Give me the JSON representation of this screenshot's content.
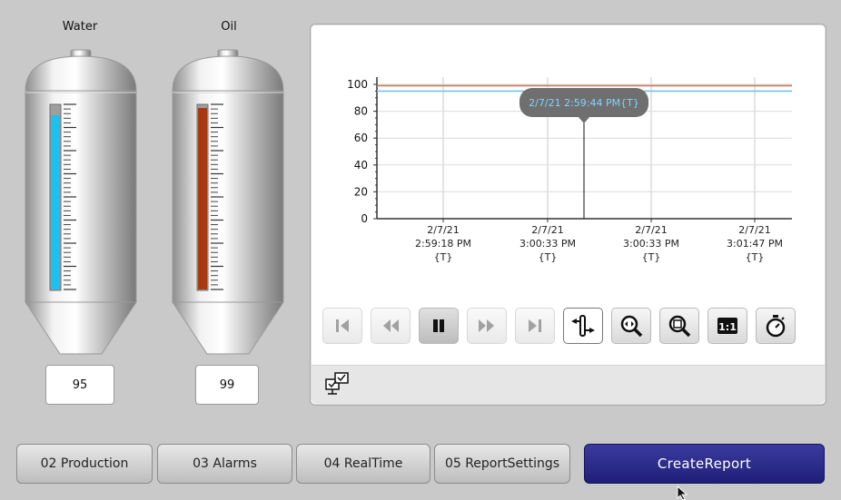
{
  "tanks": [
    {
      "label": "Water",
      "value": "95",
      "level": 0.95,
      "color": "#1ec0f2"
    },
    {
      "label": "Oil",
      "value": "99",
      "level": 0.99,
      "color": "#a83a12"
    }
  ],
  "chart_data": {
    "type": "line",
    "y_ticks": [
      "100",
      "80",
      "60",
      "40",
      "20",
      "0"
    ],
    "ylim": [
      0,
      100
    ],
    "x_ticks": [
      {
        "date": "2/7/21",
        "time": "2:59:18 PM",
        "zone": "{T}"
      },
      {
        "date": "2/7/21",
        "time": "3:00:33 PM",
        "zone": "{T}"
      },
      {
        "date": "2/7/21",
        "time": "3:00:33 PM",
        "zone": "{T}"
      },
      {
        "date": "2/7/21",
        "time": "3:01:47 PM",
        "zone": "{T}"
      }
    ],
    "series": [
      {
        "values": [
          99,
          99
        ],
        "color": "#c87a5a"
      },
      {
        "values": [
          95,
          95
        ],
        "color": "#6cc6ee"
      }
    ],
    "cursor_tooltip": "2/7/21 2:59:44 PM{T}"
  },
  "toolbar": {
    "buttons": [
      {
        "icon": "skip-to-start-icon",
        "enabled": false
      },
      {
        "icon": "rewind-icon",
        "enabled": false
      },
      {
        "icon": "pause-icon",
        "enabled": true
      },
      {
        "icon": "fast-forward-icon",
        "enabled": false
      },
      {
        "icon": "skip-to-end-icon",
        "enabled": false
      },
      {
        "icon": "ruler-cursor-icon",
        "enabled": true
      },
      {
        "icon": "zoom-time-icon",
        "enabled": true
      },
      {
        "icon": "zoom-icon",
        "enabled": true
      },
      {
        "icon": "original-size-icon",
        "enabled": true
      },
      {
        "icon": "stopwatch-icon",
        "enabled": true
      }
    ],
    "one_to_one_label": "1:1",
    "status_icon": "connected-screens-icon"
  },
  "nav": {
    "items": [
      "02 Production",
      "03 Alarms",
      "04 RealTime",
      "05 ReportSettings"
    ],
    "create_report": "CreateReport"
  }
}
